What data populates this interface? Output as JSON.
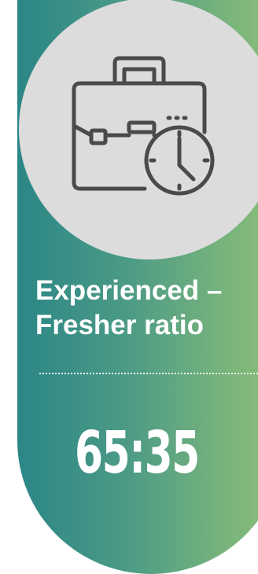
{
  "card": {
    "title_line1": "Experienced –",
    "title_line2": "Fresher ratio",
    "value": "65:35",
    "icon": "briefcase-clock-icon",
    "colors": {
      "gradient_start": "#2b8686",
      "gradient_end": "#8fbe78",
      "circle": "#dcdcdd",
      "icon_stroke": "#4a4a4a",
      "text": "#ffffff"
    }
  }
}
